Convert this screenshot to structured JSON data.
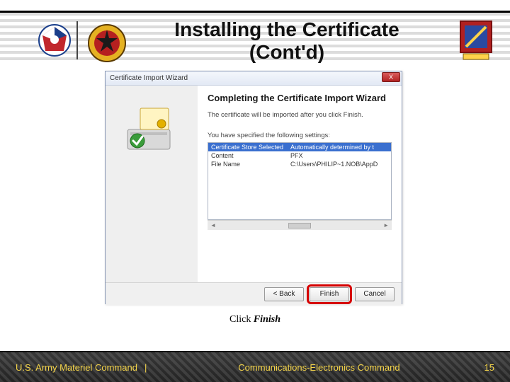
{
  "header": {
    "title": "Installing the Certificate (Cont'd)"
  },
  "wizard": {
    "window_title": "Certificate Import Wizard",
    "heading": "Completing the Certificate Import Wizard",
    "subtext": "The certificate will be imported after you click Finish.",
    "settings_label": "You have specified the following settings:",
    "settings": {
      "header_col1": "Certificate Store Selected",
      "header_col2": "Automatically determined by t",
      "rows": [
        {
          "label": "Content",
          "value": "PFX"
        },
        {
          "label": "File Name",
          "value": "C:\\Users\\PHILIP~1.NOB\\AppD"
        }
      ]
    },
    "buttons": {
      "back": "< Back",
      "finish": "Finish",
      "cancel": "Cancel"
    },
    "close_x": "X"
  },
  "instruction": {
    "prefix": "Click ",
    "emph": "Finish"
  },
  "footer": {
    "left": "U.S. Army Materiel Command",
    "sep": "|",
    "center": "Communications-Electronics Command",
    "page": "15"
  }
}
